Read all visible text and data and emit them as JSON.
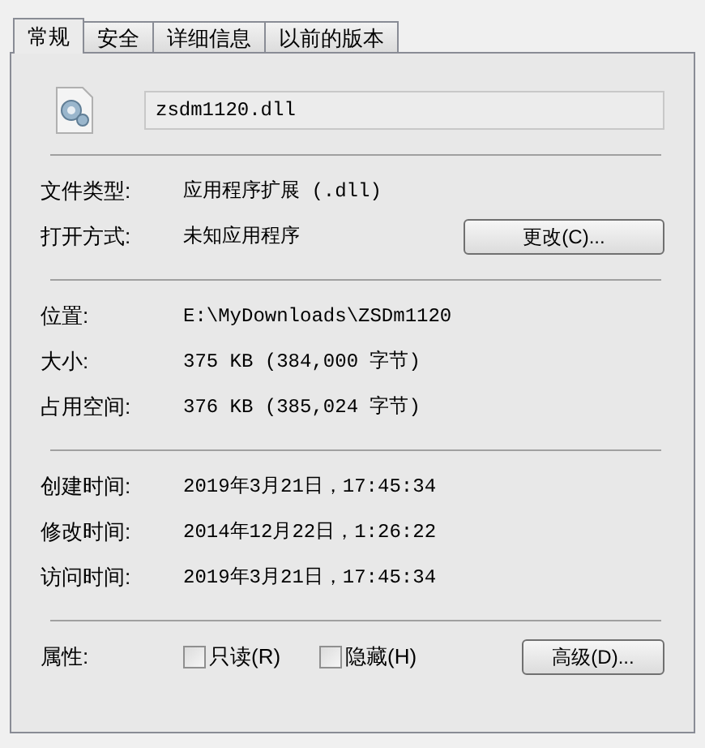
{
  "tabs": [
    {
      "label": "常规",
      "selected": true
    },
    {
      "label": "安全",
      "selected": false
    },
    {
      "label": "详细信息",
      "selected": false
    },
    {
      "label": "以前的版本",
      "selected": false
    }
  ],
  "file_name": "zsdm1120.dll",
  "groups": [
    [
      {
        "label": "文件类型:",
        "value": "应用程序扩展 (.dll)"
      },
      {
        "label": "打开方式:",
        "value": "未知应用程序",
        "button": "更改(C)..."
      }
    ],
    [
      {
        "label": "位置:",
        "value": "E:\\MyDownloads\\ZSDm1120"
      },
      {
        "label": "大小:",
        "value": "375 KB (384,000 字节)"
      },
      {
        "label": "占用空间:",
        "value": "376 KB (385,024 字节)"
      }
    ],
    [
      {
        "label": "创建时间:",
        "value": "2019年3月21日，17:45:34"
      },
      {
        "label": "修改时间:",
        "value": "2014年12月22日，1:26:22"
      },
      {
        "label": "访问时间:",
        "value": "2019年3月21日，17:45:34"
      }
    ]
  ],
  "attributes": {
    "label": "属性:",
    "checkboxes": [
      {
        "label": "只读(R)",
        "checked": false
      },
      {
        "label": "隐藏(H)",
        "checked": false
      }
    ],
    "button": "高级(D)..."
  }
}
